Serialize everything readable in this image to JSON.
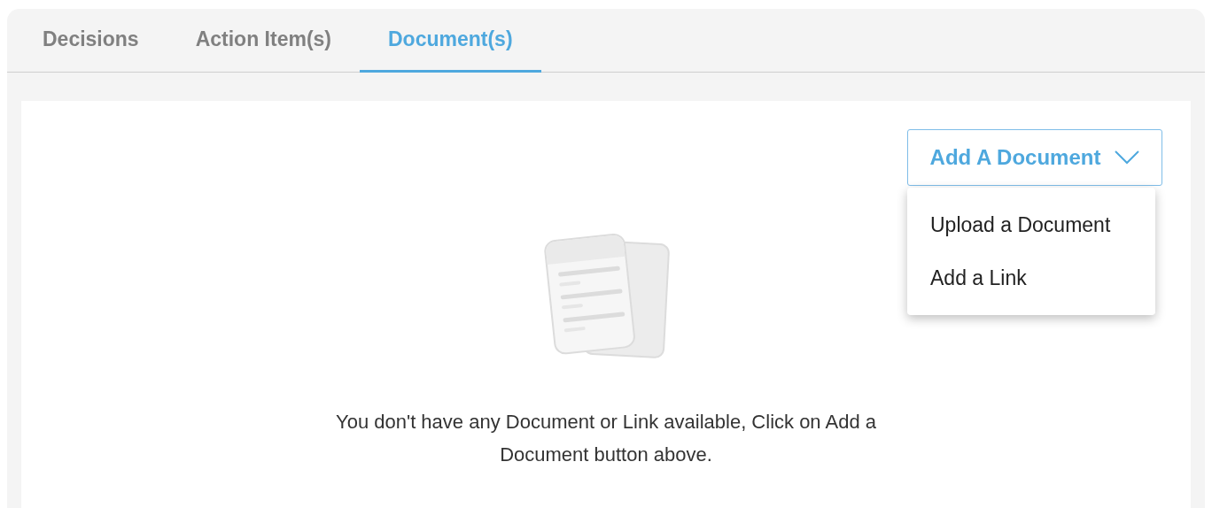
{
  "tabs": [
    {
      "label": "Decisions",
      "selected": false
    },
    {
      "label": "Action Item(s)",
      "selected": false
    },
    {
      "label": "Document(s)",
      "selected": true
    }
  ],
  "add_button": {
    "label": "Add A Document",
    "expanded": true
  },
  "menu": [
    "Upload a Document",
    "Add a Link"
  ],
  "empty_message": "You don't have any Document or Link available, Click on Add a Document button above."
}
